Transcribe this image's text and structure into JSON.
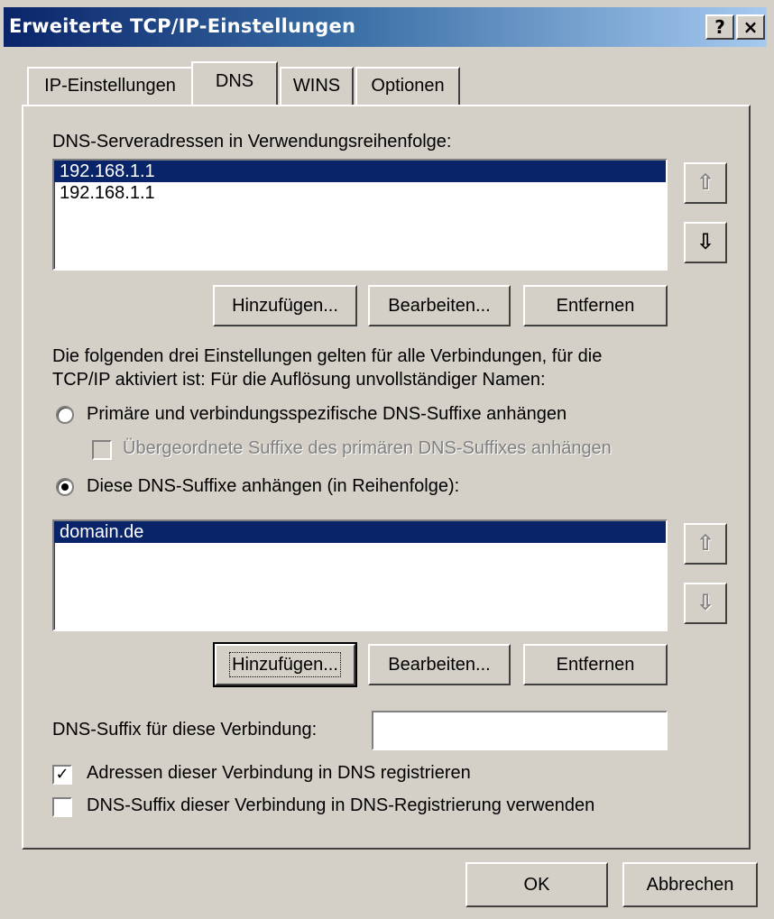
{
  "window": {
    "title": "Erweiterte TCP/IP-Einstellungen",
    "help_button": "?",
    "close_button": "×"
  },
  "tabs": [
    {
      "label": "IP-Einstellungen",
      "active": false
    },
    {
      "label": "DNS",
      "active": true
    },
    {
      "label": "WINS",
      "active": false
    },
    {
      "label": "Optionen",
      "active": false
    }
  ],
  "dns_servers": {
    "label": "DNS-Serveradressen in Verwendungsreihenfolge:",
    "items": [
      "192.168.1.1",
      "192.168.1.1"
    ],
    "selected_index": 0,
    "up_icon": "arrow-up-icon",
    "down_icon": "arrow-down-icon",
    "add_label": "Hinzufügen...",
    "edit_label": "Bearbeiten...",
    "remove_label": "Entfernen"
  },
  "description": {
    "line1": "Die folgenden drei Einstellungen gelten für alle Verbindungen, für die",
    "line2": "TCP/IP aktiviert ist: Für die Auflösung unvollständiger Namen:"
  },
  "options": {
    "radio_primary_label": "Primäre und verbindungsspezifische DNS-Suffixe anhängen",
    "radio_primary_checked": false,
    "parent_suffix_label": "Übergeordnete Suffixe des primären DNS-Suffixes anhängen",
    "parent_suffix_checked": false,
    "radio_these_label": "Diese DNS-Suffixe anhängen (in Reihenfolge):",
    "radio_these_checked": true
  },
  "suffixes": {
    "items": [
      "domain.de"
    ],
    "selected_index": 0,
    "add_label": "Hinzufügen...",
    "edit_label": "Bearbeiten...",
    "remove_label": "Entfernen"
  },
  "connection_suffix": {
    "label": "DNS-Suffix für diese Verbindung:",
    "value": ""
  },
  "register": {
    "label": "Adressen dieser Verbindung in DNS registrieren",
    "checked": true
  },
  "use_suffix": {
    "label": "DNS-Suffix dieser Verbindung in DNS-Registrierung verwenden",
    "checked": false
  },
  "footer": {
    "ok_label": "OK",
    "cancel_label": "Abbrechen"
  }
}
